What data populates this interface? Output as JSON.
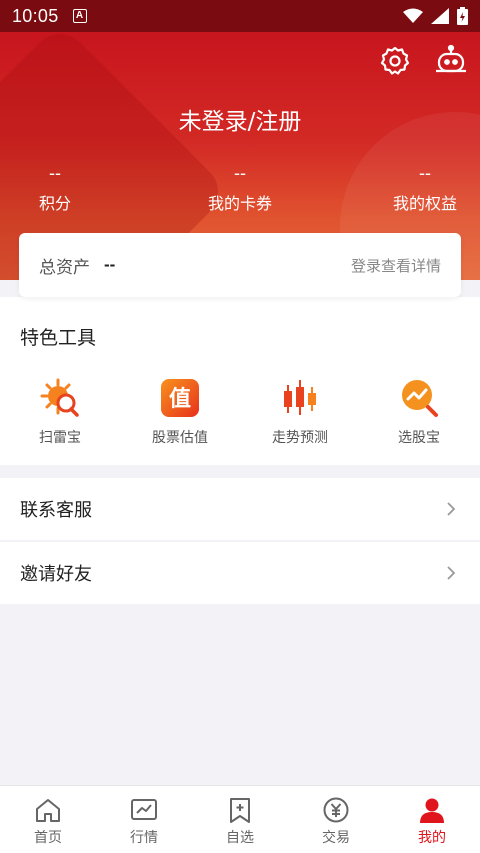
{
  "status_bar": {
    "time": "10:05",
    "badge": "A"
  },
  "header": {
    "login_title": "未登录/注册",
    "stats": [
      {
        "value": "--",
        "label": "积分"
      },
      {
        "value": "--",
        "label": "我的卡券"
      },
      {
        "value": "--",
        "label": "我的权益"
      }
    ],
    "icons": [
      "settings-icon",
      "robot-icon"
    ]
  },
  "assets": {
    "label": "总资产",
    "value": "--",
    "link": "登录查看详情"
  },
  "tools": {
    "title": "特色工具",
    "items": [
      {
        "label": "扫雷宝",
        "icon": "minesweeper-icon"
      },
      {
        "label": "股票估值",
        "icon": "valuation-icon",
        "icon_text": "值"
      },
      {
        "label": "走势预测",
        "icon": "candlestick-icon"
      },
      {
        "label": "选股宝",
        "icon": "stock-picker-icon"
      }
    ]
  },
  "menu": [
    {
      "label": "联系客服"
    },
    {
      "label": "邀请好友"
    }
  ],
  "tabbar": {
    "active": "我的",
    "items": [
      {
        "label": "首页",
        "icon": "home-icon"
      },
      {
        "label": "行情",
        "icon": "market-icon"
      },
      {
        "label": "自选",
        "icon": "watchlist-icon"
      },
      {
        "label": "交易",
        "icon": "trade-icon"
      },
      {
        "label": "我的",
        "icon": "profile-icon"
      }
    ]
  },
  "colors": {
    "brand_red": "#d32a25",
    "active_tab": "#e0141c",
    "icon_orange": "#f5821f"
  }
}
